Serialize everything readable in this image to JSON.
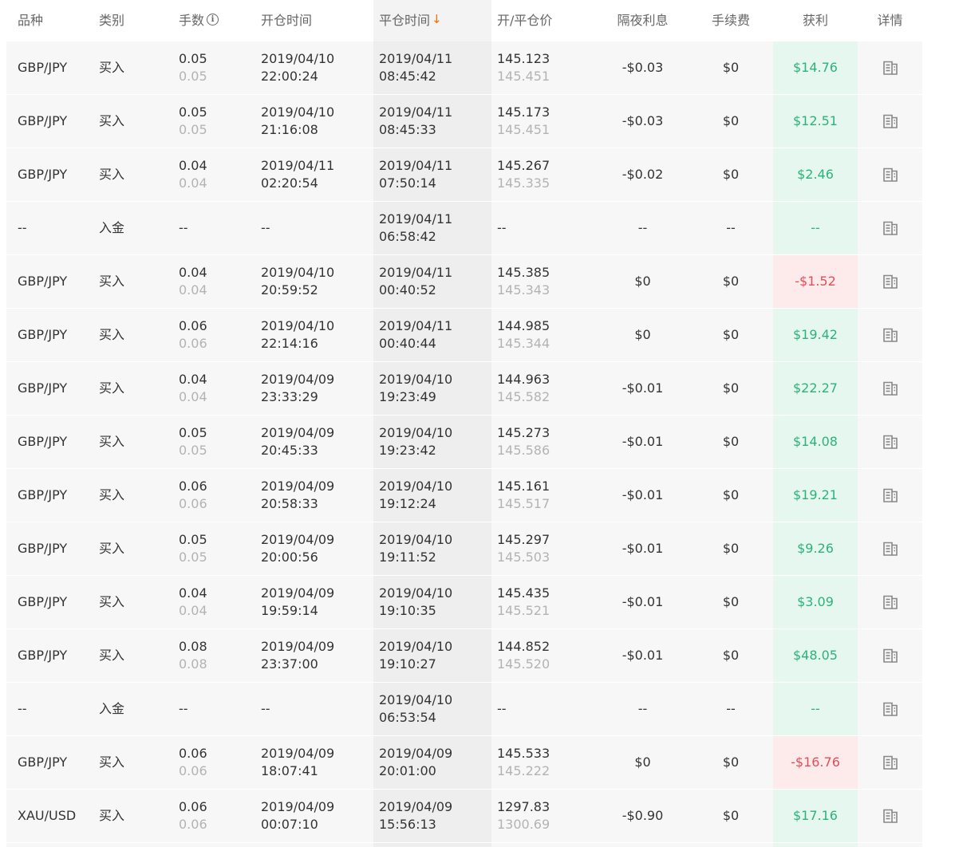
{
  "colors": {
    "profit_positive": "#2db37a",
    "profit_positive_bg": "#e6f7f0",
    "profit_negative": "#e0505a",
    "profit_negative_bg": "#fdeaea",
    "sort_accent": "#ff6a00"
  },
  "headers": {
    "symbol": "品种",
    "type": "类别",
    "lots": "手数",
    "open_time": "开仓时间",
    "close_time": "平仓时间",
    "price": "开/平仓价",
    "swap": "隔夜利息",
    "fee": "手续费",
    "profit": "获利",
    "detail": "详情",
    "lots_icon": "info-icon",
    "sort_icon": "arrow-down-icon",
    "detail_icon": "document-icon"
  },
  "rows": [
    {
      "symbol": "GBP/JPY",
      "type": "买入",
      "lots": "0.05",
      "lots2": "0.05",
      "open_date": "2019/04/10",
      "open_time": "22:00:24",
      "close_date": "2019/04/11",
      "close_time": "08:45:42",
      "open_price": "145.123",
      "close_price": "145.451",
      "swap": "-$0.03",
      "fee": "$0",
      "profit": "$14.76",
      "profit_sign": "pos"
    },
    {
      "symbol": "GBP/JPY",
      "type": "买入",
      "lots": "0.05",
      "lots2": "0.05",
      "open_date": "2019/04/10",
      "open_time": "21:16:08",
      "close_date": "2019/04/11",
      "close_time": "08:45:33",
      "open_price": "145.173",
      "close_price": "145.451",
      "swap": "-$0.03",
      "fee": "$0",
      "profit": "$12.51",
      "profit_sign": "pos"
    },
    {
      "symbol": "GBP/JPY",
      "type": "买入",
      "lots": "0.04",
      "lots2": "0.04",
      "open_date": "2019/04/11",
      "open_time": "02:20:54",
      "close_date": "2019/04/11",
      "close_time": "07:50:14",
      "open_price": "145.267",
      "close_price": "145.335",
      "swap": "-$0.02",
      "fee": "$0",
      "profit": "$2.46",
      "profit_sign": "pos"
    },
    {
      "symbol": "--",
      "type": "入金",
      "lots": "--",
      "lots2": "",
      "open_date": "--",
      "open_time": "",
      "close_date": "2019/04/11",
      "close_time": "06:58:42",
      "open_price": "--",
      "close_price": "",
      "swap": "--",
      "fee": "--",
      "profit": "--",
      "profit_sign": "pos"
    },
    {
      "symbol": "GBP/JPY",
      "type": "买入",
      "lots": "0.04",
      "lots2": "0.04",
      "open_date": "2019/04/10",
      "open_time": "20:59:52",
      "close_date": "2019/04/11",
      "close_time": "00:40:52",
      "open_price": "145.385",
      "close_price": "145.343",
      "swap": "$0",
      "fee": "$0",
      "profit": "-$1.52",
      "profit_sign": "neg"
    },
    {
      "symbol": "GBP/JPY",
      "type": "买入",
      "lots": "0.06",
      "lots2": "0.06",
      "open_date": "2019/04/10",
      "open_time": "22:14:16",
      "close_date": "2019/04/11",
      "close_time": "00:40:44",
      "open_price": "144.985",
      "close_price": "145.344",
      "swap": "$0",
      "fee": "$0",
      "profit": "$19.42",
      "profit_sign": "pos"
    },
    {
      "symbol": "GBP/JPY",
      "type": "买入",
      "lots": "0.04",
      "lots2": "0.04",
      "open_date": "2019/04/09",
      "open_time": "23:33:29",
      "close_date": "2019/04/10",
      "close_time": "19:23:49",
      "open_price": "144.963",
      "close_price": "145.582",
      "swap": "-$0.01",
      "fee": "$0",
      "profit": "$22.27",
      "profit_sign": "pos"
    },
    {
      "symbol": "GBP/JPY",
      "type": "买入",
      "lots": "0.05",
      "lots2": "0.05",
      "open_date": "2019/04/09",
      "open_time": "20:45:33",
      "close_date": "2019/04/10",
      "close_time": "19:23:42",
      "open_price": "145.273",
      "close_price": "145.586",
      "swap": "-$0.01",
      "fee": "$0",
      "profit": "$14.08",
      "profit_sign": "pos"
    },
    {
      "symbol": "GBP/JPY",
      "type": "买入",
      "lots": "0.06",
      "lots2": "0.06",
      "open_date": "2019/04/09",
      "open_time": "20:58:33",
      "close_date": "2019/04/10",
      "close_time": "19:12:24",
      "open_price": "145.161",
      "close_price": "145.517",
      "swap": "-$0.01",
      "fee": "$0",
      "profit": "$19.21",
      "profit_sign": "pos"
    },
    {
      "symbol": "GBP/JPY",
      "type": "买入",
      "lots": "0.05",
      "lots2": "0.05",
      "open_date": "2019/04/09",
      "open_time": "20:00:56",
      "close_date": "2019/04/10",
      "close_time": "19:11:52",
      "open_price": "145.297",
      "close_price": "145.503",
      "swap": "-$0.01",
      "fee": "$0",
      "profit": "$9.26",
      "profit_sign": "pos"
    },
    {
      "symbol": "GBP/JPY",
      "type": "买入",
      "lots": "0.04",
      "lots2": "0.04",
      "open_date": "2019/04/09",
      "open_time": "19:59:14",
      "close_date": "2019/04/10",
      "close_time": "19:10:35",
      "open_price": "145.435",
      "close_price": "145.521",
      "swap": "-$0.01",
      "fee": "$0",
      "profit": "$3.09",
      "profit_sign": "pos"
    },
    {
      "symbol": "GBP/JPY",
      "type": "买入",
      "lots": "0.08",
      "lots2": "0.08",
      "open_date": "2019/04/09",
      "open_time": "23:37:00",
      "close_date": "2019/04/10",
      "close_time": "19:10:27",
      "open_price": "144.852",
      "close_price": "145.520",
      "swap": "-$0.01",
      "fee": "$0",
      "profit": "$48.05",
      "profit_sign": "pos"
    },
    {
      "symbol": "--",
      "type": "入金",
      "lots": "--",
      "lots2": "",
      "open_date": "--",
      "open_time": "",
      "close_date": "2019/04/10",
      "close_time": "06:53:54",
      "open_price": "--",
      "close_price": "",
      "swap": "--",
      "fee": "--",
      "profit": "--",
      "profit_sign": "pos"
    },
    {
      "symbol": "GBP/JPY",
      "type": "买入",
      "lots": "0.06",
      "lots2": "0.06",
      "open_date": "2019/04/09",
      "open_time": "18:07:41",
      "close_date": "2019/04/09",
      "close_time": "20:01:00",
      "open_price": "145.533",
      "close_price": "145.222",
      "swap": "$0",
      "fee": "$0",
      "profit": "-$16.76",
      "profit_sign": "neg"
    },
    {
      "symbol": "XAU/USD",
      "type": "买入",
      "lots": "0.06",
      "lots2": "0.06",
      "open_date": "2019/04/09",
      "open_time": "00:07:10",
      "close_date": "2019/04/09",
      "close_time": "15:56:13",
      "open_price": "1297.83",
      "close_price": "1300.69",
      "swap": "-$0.90",
      "fee": "$0",
      "profit": "$17.16",
      "profit_sign": "pos"
    }
  ]
}
